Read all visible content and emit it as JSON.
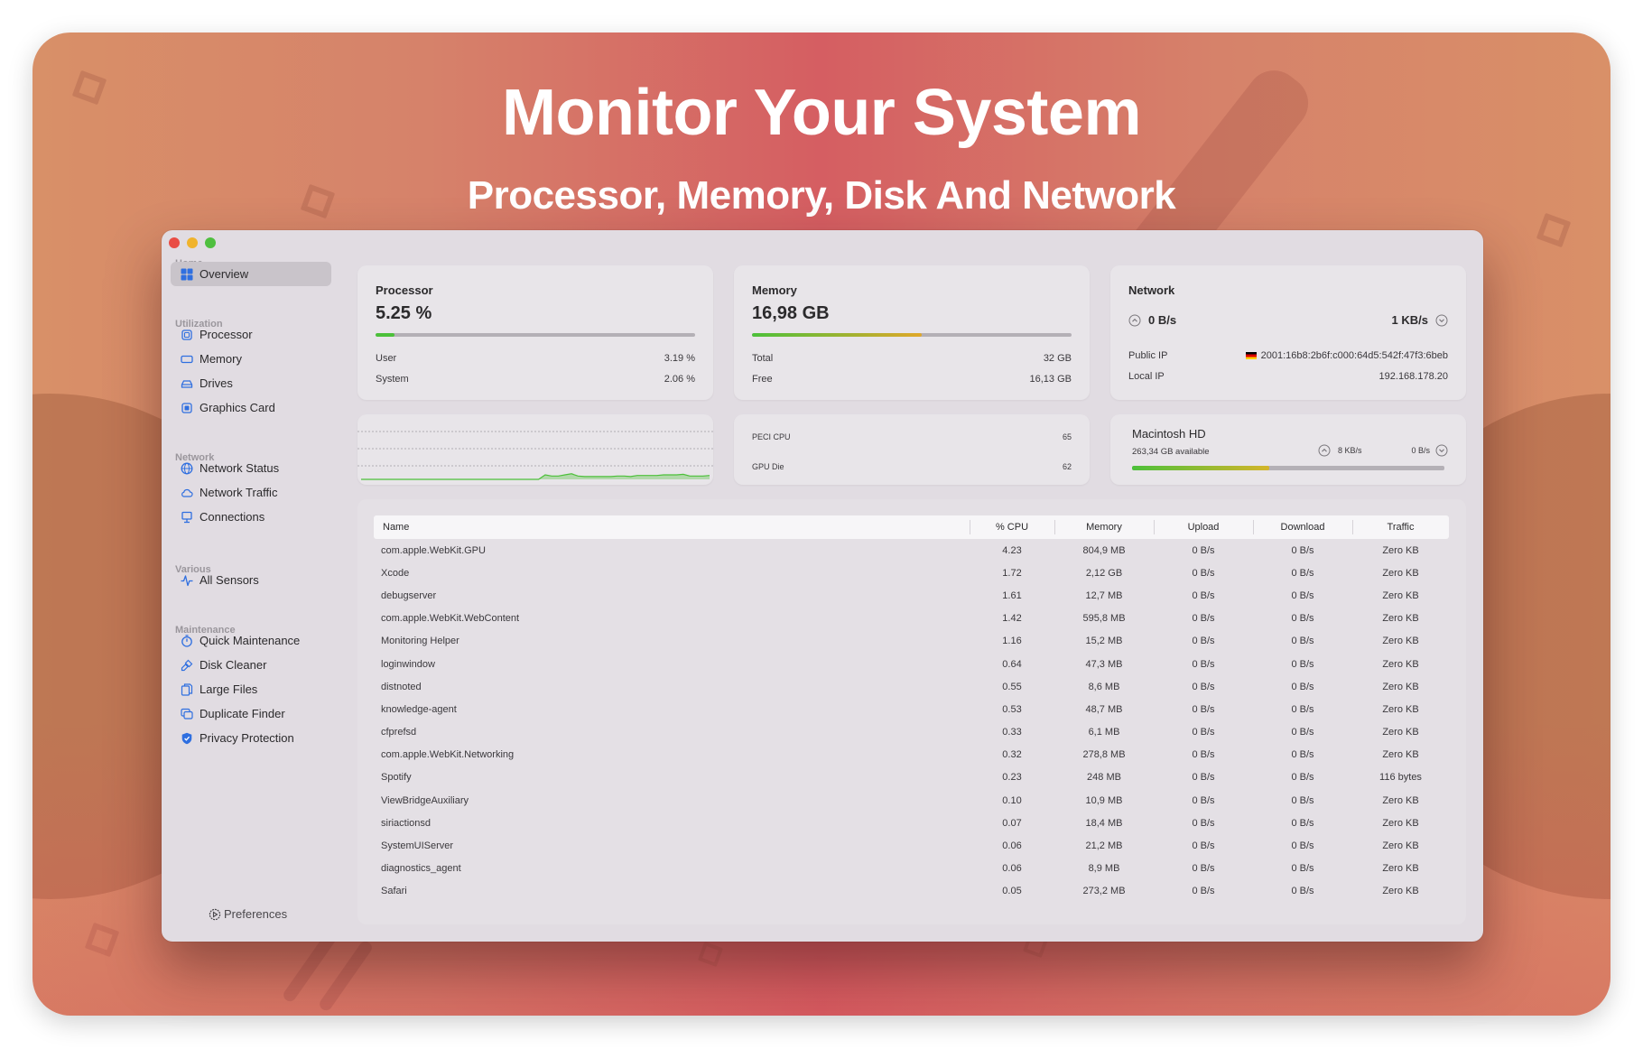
{
  "banner": {
    "headline": "Monitor Your System",
    "subline": "Processor, Memory, Disk And Network"
  },
  "window": {
    "traffic_lights": [
      "close",
      "minimize",
      "zoom"
    ]
  },
  "sidebar": {
    "sections": [
      {
        "label": "Home",
        "items": [
          {
            "label": "Overview",
            "icon": "grid-icon",
            "active": true
          }
        ]
      },
      {
        "label": "Utilization",
        "items": [
          {
            "label": "Processor",
            "icon": "cpu-chip-icon"
          },
          {
            "label": "Memory",
            "icon": "memory-icon"
          },
          {
            "label": "Drives",
            "icon": "drive-icon"
          },
          {
            "label": "Graphics Card",
            "icon": "gpu-chip-icon"
          }
        ]
      },
      {
        "label": "Network",
        "items": [
          {
            "label": "Network Status",
            "icon": "globe-icon"
          },
          {
            "label": "Network Traffic",
            "icon": "cloud-icon"
          },
          {
            "label": "Connections",
            "icon": "desktop-icon"
          }
        ]
      },
      {
        "label": "Various",
        "items": [
          {
            "label": "All Sensors",
            "icon": "waveform-icon"
          }
        ]
      },
      {
        "label": "Maintenance",
        "items": [
          {
            "label": "Quick Maintenance",
            "icon": "timer-icon"
          },
          {
            "label": "Disk Cleaner",
            "icon": "brush-icon"
          },
          {
            "label": "Large Files",
            "icon": "documents-icon"
          },
          {
            "label": "Duplicate Finder",
            "icon": "duplicate-icon"
          },
          {
            "label": "Privacy Protection",
            "icon": "shield-check-icon"
          }
        ]
      }
    ],
    "preferences_label": "Preferences"
  },
  "processor": {
    "title": "Processor",
    "value": "5.25 %",
    "usage_fraction": 0.0525,
    "user_label": "User",
    "user_value": "3.19 %",
    "system_label": "System",
    "system_value": "2.06 %",
    "color": "#4cc03a"
  },
  "memory": {
    "title": "Memory",
    "value": "16,98 GB",
    "usage_fraction": 0.53,
    "total_label": "Total",
    "total_value": "32 GB",
    "free_label": "Free",
    "free_value": "16,13 GB"
  },
  "network": {
    "title": "Network",
    "upload": "0 B/s",
    "download": "1 KB/s",
    "public_ip_label": "Public IP",
    "public_ip_flag": "Germany",
    "public_ip": "2001:16b8:2b6f:c000:64d5:542f:47f3:6beb",
    "local_ip_label": "Local IP",
    "local_ip": "192.168.178.20"
  },
  "cpu_history": {
    "series": [
      0,
      0,
      0,
      0,
      0,
      0,
      0,
      0,
      0,
      0,
      0,
      0,
      0,
      0,
      0,
      0,
      0,
      0,
      0,
      0,
      0,
      0,
      0,
      0,
      0,
      0,
      0,
      0,
      0.08,
      0.06,
      0.06,
      0.08,
      0.1,
      0.06,
      0.05,
      0.05,
      0.05,
      0.05,
      0.05,
      0.06,
      0.06,
      0.05,
      0.07,
      0.07,
      0.07,
      0.07,
      0.08,
      0.08,
      0.08,
      0.09,
      0.06,
      0.06,
      0.06,
      0.07
    ]
  },
  "sensors": [
    {
      "label": "PECI CPU",
      "value": "65"
    },
    {
      "label": "GPU Die",
      "value": "62"
    }
  ],
  "disk": {
    "name": "Macintosh HD",
    "available": "263,34 GB available",
    "read": "8 KB/s",
    "write": "0 B/s",
    "usage_fraction": 0.44
  },
  "table": {
    "headers": [
      "Name",
      "% CPU",
      "Memory",
      "Upload",
      "Download",
      "Traffic"
    ],
    "rows": [
      [
        "com.apple.WebKit.GPU",
        "4.23",
        "804,9 MB",
        "0 B/s",
        "0 B/s",
        "Zero KB"
      ],
      [
        "Xcode",
        "1.72",
        "2,12 GB",
        "0 B/s",
        "0 B/s",
        "Zero KB"
      ],
      [
        "debugserver",
        "1.61",
        "12,7 MB",
        "0 B/s",
        "0 B/s",
        "Zero KB"
      ],
      [
        "com.apple.WebKit.WebContent",
        "1.42",
        "595,8 MB",
        "0 B/s",
        "0 B/s",
        "Zero KB"
      ],
      [
        "Monitoring Helper",
        "1.16",
        "15,2 MB",
        "0 B/s",
        "0 B/s",
        "Zero KB"
      ],
      [
        "loginwindow",
        "0.64",
        "47,3 MB",
        "0 B/s",
        "0 B/s",
        "Zero KB"
      ],
      [
        "distnoted",
        "0.55",
        "8,6 MB",
        "0 B/s",
        "0 B/s",
        "Zero KB"
      ],
      [
        "knowledge-agent",
        "0.53",
        "48,7 MB",
        "0 B/s",
        "0 B/s",
        "Zero KB"
      ],
      [
        "cfprefsd",
        "0.33",
        "6,1 MB",
        "0 B/s",
        "0 B/s",
        "Zero KB"
      ],
      [
        "com.apple.WebKit.Networking",
        "0.32",
        "278,8 MB",
        "0 B/s",
        "0 B/s",
        "Zero KB"
      ],
      [
        "Spotify",
        "0.23",
        "248 MB",
        "0 B/s",
        "0 B/s",
        "116 bytes"
      ],
      [
        "ViewBridgeAuxiliary",
        "0.10",
        "10,9 MB",
        "0 B/s",
        "0 B/s",
        "Zero KB"
      ],
      [
        "siriactionsd",
        "0.07",
        "18,4 MB",
        "0 B/s",
        "0 B/s",
        "Zero KB"
      ],
      [
        "SystemUIServer",
        "0.06",
        "21,2 MB",
        "0 B/s",
        "0 B/s",
        "Zero KB"
      ],
      [
        "diagnostics_agent",
        "0.06",
        "8,9 MB",
        "0 B/s",
        "0 B/s",
        "Zero KB"
      ],
      [
        "Safari",
        "0.05",
        "273,2 MB",
        "0 B/s",
        "0 B/s",
        "Zero KB"
      ]
    ]
  },
  "colors": {
    "accent": "#2f6fe0",
    "green": "#4cc03a",
    "amber": "#e0a82a"
  }
}
